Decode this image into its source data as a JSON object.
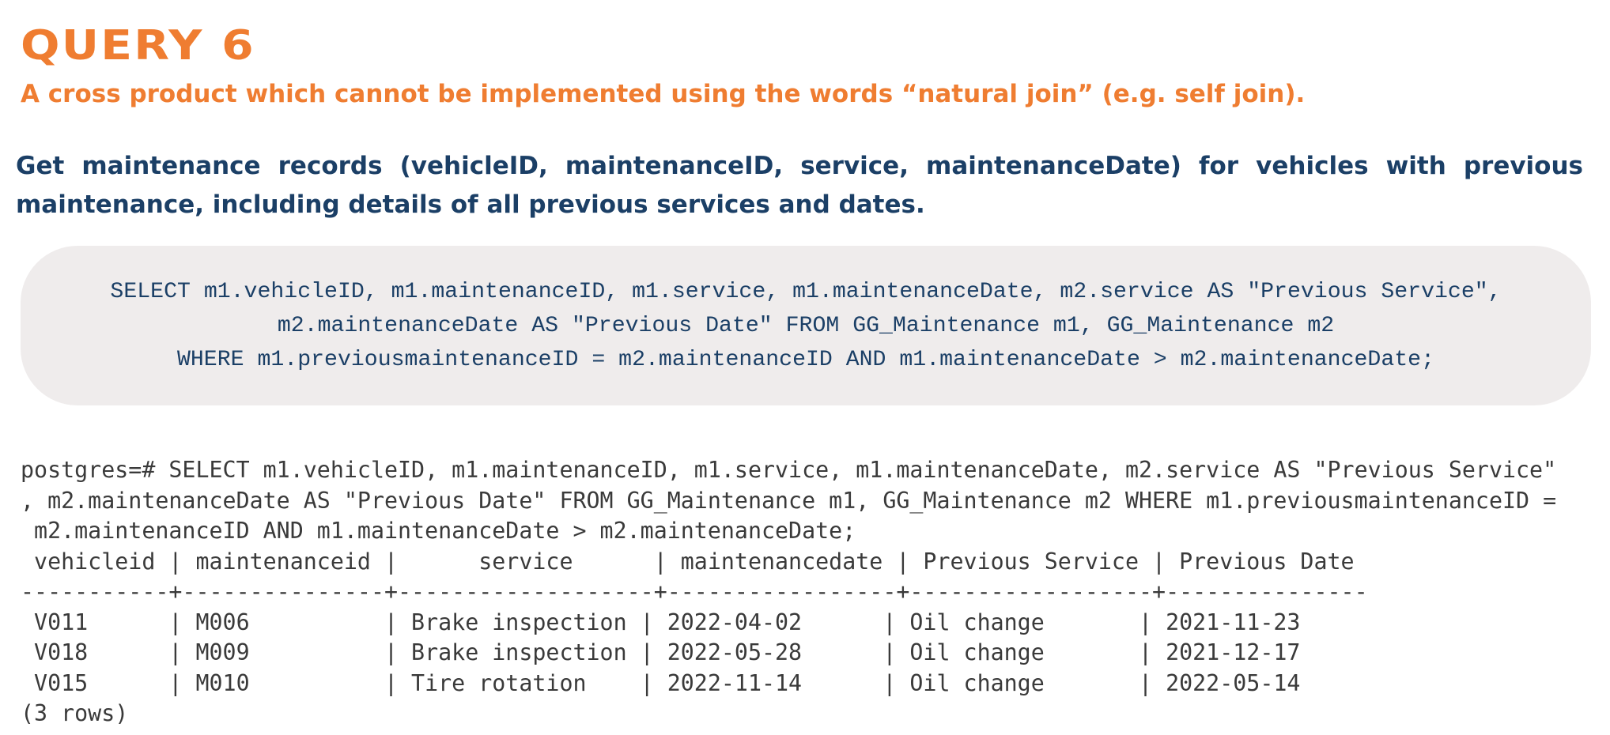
{
  "query": {
    "title": "QUERY 6",
    "subtitle": "A cross product which cannot be implemented using the words “natural join” (e.g. self join).",
    "description": "Get maintenance records (vehicleID, maintenanceID, service, maintenanceDate) for vehicles with previous maintenance, including details of all previous services and dates."
  },
  "sql": {
    "line1": "SELECT m1.vehicleID, m1.maintenanceID, m1.service, m1.maintenanceDate, m2.service AS \"Previous Service\",",
    "line2": "m2.maintenanceDate AS \"Previous Date\" FROM GG_Maintenance m1, GG_Maintenance m2",
    "line3": "WHERE m1.previousmaintenanceID = m2.maintenanceID AND m1.maintenanceDate > m2.maintenanceDate;"
  },
  "terminal": {
    "command_line1": "postgres=# SELECT m1.vehicleID, m1.maintenanceID, m1.service, m1.maintenanceDate, m2.service AS \"Previous Service\"",
    "command_line2": ", m2.maintenanceDate AS \"Previous Date\" FROM GG_Maintenance m1, GG_Maintenance m2 WHERE m1.previousmaintenanceID =",
    "command_line3": " m2.maintenanceID AND m1.maintenanceDate > m2.maintenanceDate;",
    "header": " vehicleid | maintenanceid |      service      | maintenancedate | Previous Service | Previous Date",
    "separator": "-----------+---------------+-------------------+-----------------+------------------+---------------",
    "rows": [
      " V011      | M006          | Brake inspection | 2022-04-02      | Oil change       | 2021-11-23",
      " V018      | M009          | Brake inspection | 2022-05-28      | Oil change       | 2021-12-17",
      " V015      | M010          | Tire rotation    | 2022-11-14      | Oil change       | 2022-05-14"
    ],
    "row_count": "(3 rows)"
  }
}
